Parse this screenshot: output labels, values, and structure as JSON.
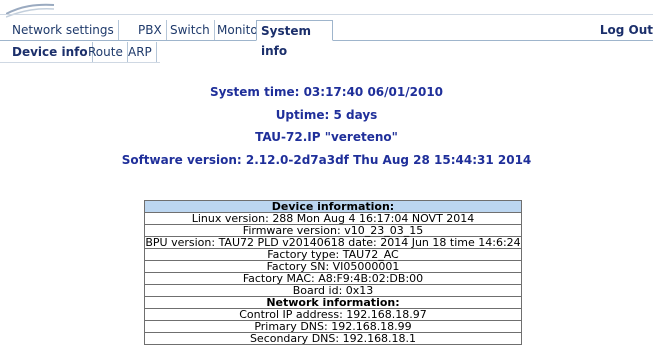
{
  "nav": {
    "tabs": [
      {
        "label": "Network settings"
      },
      {
        "label": "PBX"
      },
      {
        "label": "Switch"
      },
      {
        "label": "Monitoring"
      },
      {
        "label": "System info"
      }
    ],
    "logout": "Log Out"
  },
  "subnav": {
    "tabs": [
      {
        "label": "Device info"
      },
      {
        "label": "Route"
      },
      {
        "label": "ARP"
      }
    ]
  },
  "summary": {
    "system_time": "System time: 03:17:40  06/01/2010",
    "uptime": "Uptime: 5 days",
    "device_name": "TAU-72.IP \"vereteno\"",
    "software_version": "Software version: 2.12.0-2d7a3df Thu Aug 28 15:44:31 2014"
  },
  "device_table": {
    "device_header": "Device information:",
    "rows": [
      "Linux version: 288 Mon Aug 4 16:17:04 NOVT 2014",
      "Firmware version: v10_23_03_15",
      "BPU version: TAU72 PLD v20140618 date: 2014 Jun 18 time 14:6:24",
      "Factory type: TAU72_AC",
      "Factory SN: VI05000001",
      "Factory MAC: A8:F9:4B:02:DB:00",
      "Board id: 0x13"
    ],
    "network_header": "Network information:",
    "network_rows": [
      "Control IP address: 192.168.18.97",
      "Primary DNS: 192.168.18.99",
      "Secondary DNS: 192.168.18.1"
    ]
  },
  "colors": {
    "title_blue": "#1f2f9a",
    "header_bg": "#bcd6f0",
    "nav_text": "#1f3a6b"
  }
}
